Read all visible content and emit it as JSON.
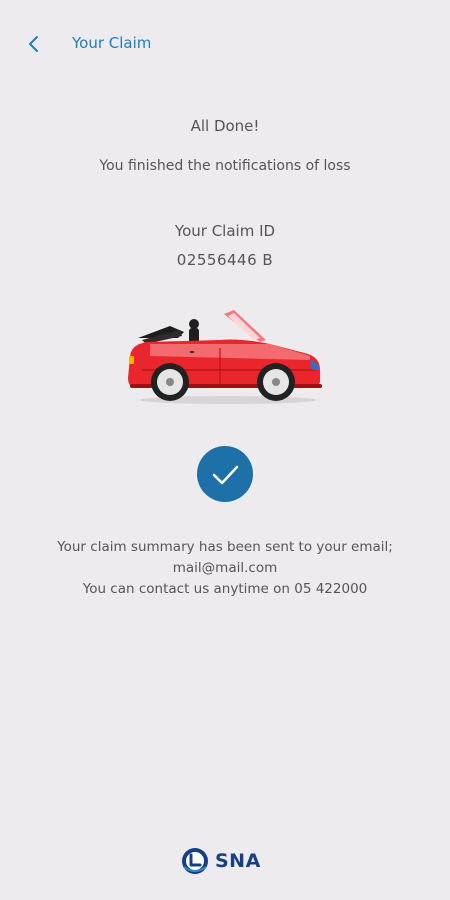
{
  "header": {
    "back_icon": "chevron-left-icon",
    "title": "Your Claim"
  },
  "confirmation": {
    "title": "All Done!",
    "subtitle": "You finished the notifications of loss",
    "claim_label": "Your Claim ID",
    "claim_id": "02556446 B",
    "illustration": "red-convertible-car",
    "status_icon": "check-circle-icon"
  },
  "summary": {
    "line1": "Your claim summary has been sent to your email;",
    "line2": "mail@mail.com",
    "line3": "You can contact us anytime on 05 422000"
  },
  "footer": {
    "logo_text": "SNA"
  },
  "colors": {
    "background": "#eeebee",
    "accent": "#1a7fc0",
    "check_circle": "#1d71a8",
    "brand": "#163f86",
    "car_body": "#e8262b"
  }
}
